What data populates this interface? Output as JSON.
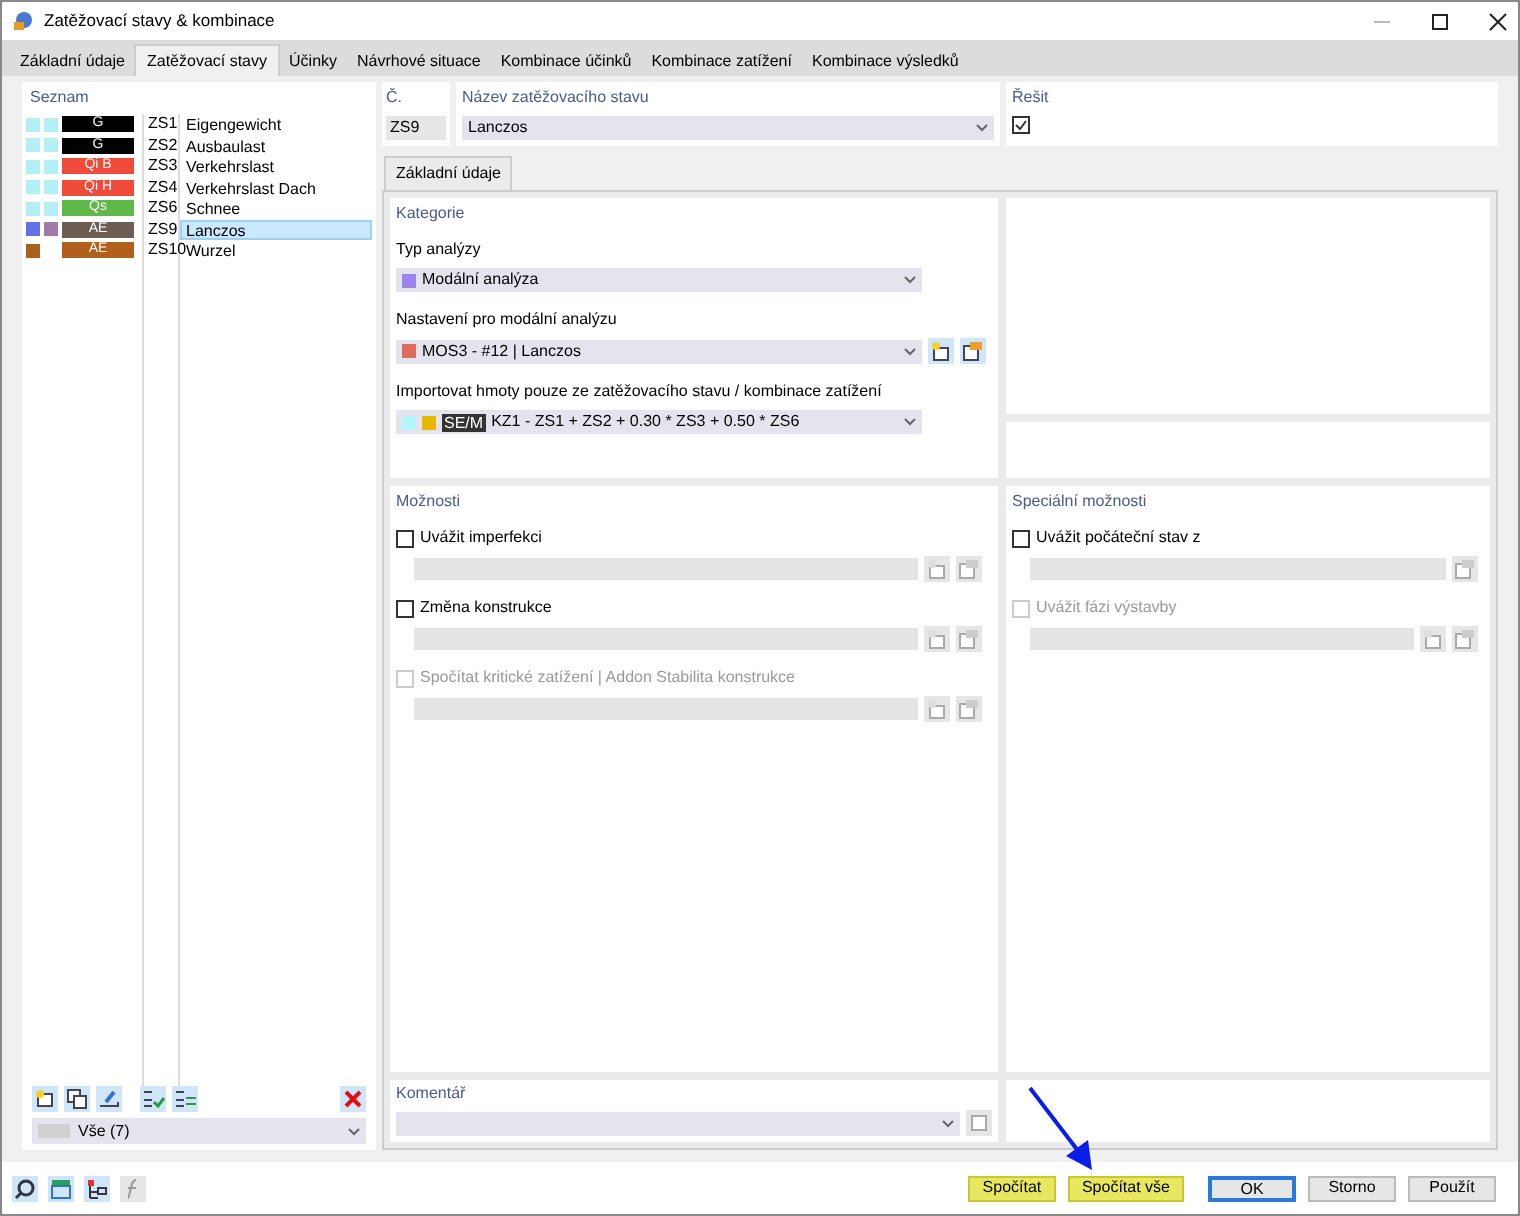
{
  "window": {
    "title": "Zatěžovací stavy & kombinace"
  },
  "tabs": [
    {
      "label": "Základní údaje",
      "selected": false
    },
    {
      "label": "Zatěžovací stavy",
      "selected": true
    },
    {
      "label": "Účinky",
      "selected": false
    },
    {
      "label": "Návrhové situace",
      "selected": false
    },
    {
      "label": "Kombinace účinků",
      "selected": false
    },
    {
      "label": "Kombinace zatížení",
      "selected": false
    },
    {
      "label": "Kombinace výsledků",
      "selected": false
    }
  ],
  "list": {
    "title": "Seznam",
    "items": [
      {
        "squares": [
          {
            "color": "#b3f0f5"
          },
          {
            "color": "#b3f0f5"
          }
        ],
        "tag": {
          "label": "G",
          "color": "#000000"
        },
        "code": "ZS1",
        "name": "Eigengewicht",
        "selected": false
      },
      {
        "squares": [
          {
            "color": "#b3f0f5"
          },
          {
            "color": "#b3f0f5"
          }
        ],
        "tag": {
          "label": "G",
          "color": "#000000"
        },
        "code": "ZS2",
        "name": "Ausbaulast",
        "selected": false
      },
      {
        "squares": [
          {
            "color": "#b3f0f5"
          },
          {
            "color": "#b3f0f5"
          }
        ],
        "tag": {
          "label": "Qi B",
          "color": "#f04a3a"
        },
        "code": "ZS3",
        "name": "Verkehrslast",
        "selected": false
      },
      {
        "squares": [
          {
            "color": "#b3f0f5"
          },
          {
            "color": "#b3f0f5"
          }
        ],
        "tag": {
          "label": "Qi H",
          "color": "#f04a3a"
        },
        "code": "ZS4",
        "name": "Verkehrslast Dach",
        "selected": false
      },
      {
        "squares": [
          {
            "color": "#b3f0f5"
          },
          {
            "color": "#b3f0f5"
          }
        ],
        "tag": {
          "label": "Qs",
          "color": "#5fb848"
        },
        "code": "ZS6",
        "name": "Schnee",
        "selected": false
      },
      {
        "squares": [
          {
            "color": "#6470e8"
          },
          {
            "color": "#a07aa8"
          }
        ],
        "tag": {
          "label": "AE",
          "color": "#6e5d52"
        },
        "code": "ZS9",
        "name": "Lanczos",
        "selected": true
      },
      {
        "squares": [
          {
            "color": "#a8601c"
          }
        ],
        "tag": {
          "label": "AE",
          "color": "#b0601c"
        },
        "code": "ZS10",
        "name": "Wurzel",
        "selected": false
      }
    ],
    "filter": "Vše (7)"
  },
  "number": {
    "label": "Č.",
    "value": "ZS9"
  },
  "name_field": {
    "label": "Název zatěžovacího stavu",
    "value": "Lanczos"
  },
  "solve": {
    "label": "Řešit",
    "checked": true
  },
  "inner_tab": {
    "label": "Základní údaje",
    "selected": true
  },
  "category": {
    "title": "Kategorie",
    "fields": [
      {
        "kind": "plain",
        "label": "Typ analýzy",
        "swatches": [
          {
            "color": "#9b84ec"
          }
        ],
        "value": "Modální analýza"
      },
      {
        "kind": "buttons",
        "label": "Nastavení pro modální analýzu",
        "swatches": [
          {
            "color": "#e06a5e"
          }
        ],
        "value": "MOS3 - #12 | Lanczos"
      },
      {
        "kind": "tagged",
        "label": "Importovat hmoty pouze ze zatěžovacího stavu / kombinace zatížení",
        "swatches": [
          {
            "color": "#b3f5f8"
          },
          {
            "color": "#e6b800"
          }
        ],
        "tag": "SE/M",
        "value": "KZ1 - ZS1 + ZS2 + 0.30 * ZS3 + 0.50 * ZS6"
      }
    ]
  },
  "options": {
    "title": "Možnosti",
    "items": [
      {
        "label": "Uvážit imperfekci",
        "checked": false,
        "disabled": false,
        "kind": "two"
      },
      {
        "label": "Změna konstrukce",
        "checked": false,
        "disabled": false,
        "kind": "two"
      },
      {
        "label": "Spočítat kritické zatížení | Addon Stabilita konstrukce",
        "checked": false,
        "disabled": true,
        "kind": "two"
      }
    ]
  },
  "special_options": {
    "title": "Speciální možnosti",
    "items": [
      {
        "label": "Uvážit počáteční stav z",
        "checked": false,
        "disabled": false,
        "kind": "one"
      },
      {
        "label": "Uvážit fázi výstavby",
        "checked": false,
        "disabled": true,
        "kind": "two"
      }
    ]
  },
  "comment": {
    "label": "Komentář"
  },
  "buttons": [
    {
      "label": "Spočítat",
      "kind": "highlight"
    },
    {
      "label": "Spočítat vše",
      "kind": "highlight"
    },
    {
      "label": "OK",
      "kind": "default"
    },
    {
      "label": "Storno",
      "kind": "plain"
    },
    {
      "label": "Použít",
      "kind": "plain"
    }
  ]
}
